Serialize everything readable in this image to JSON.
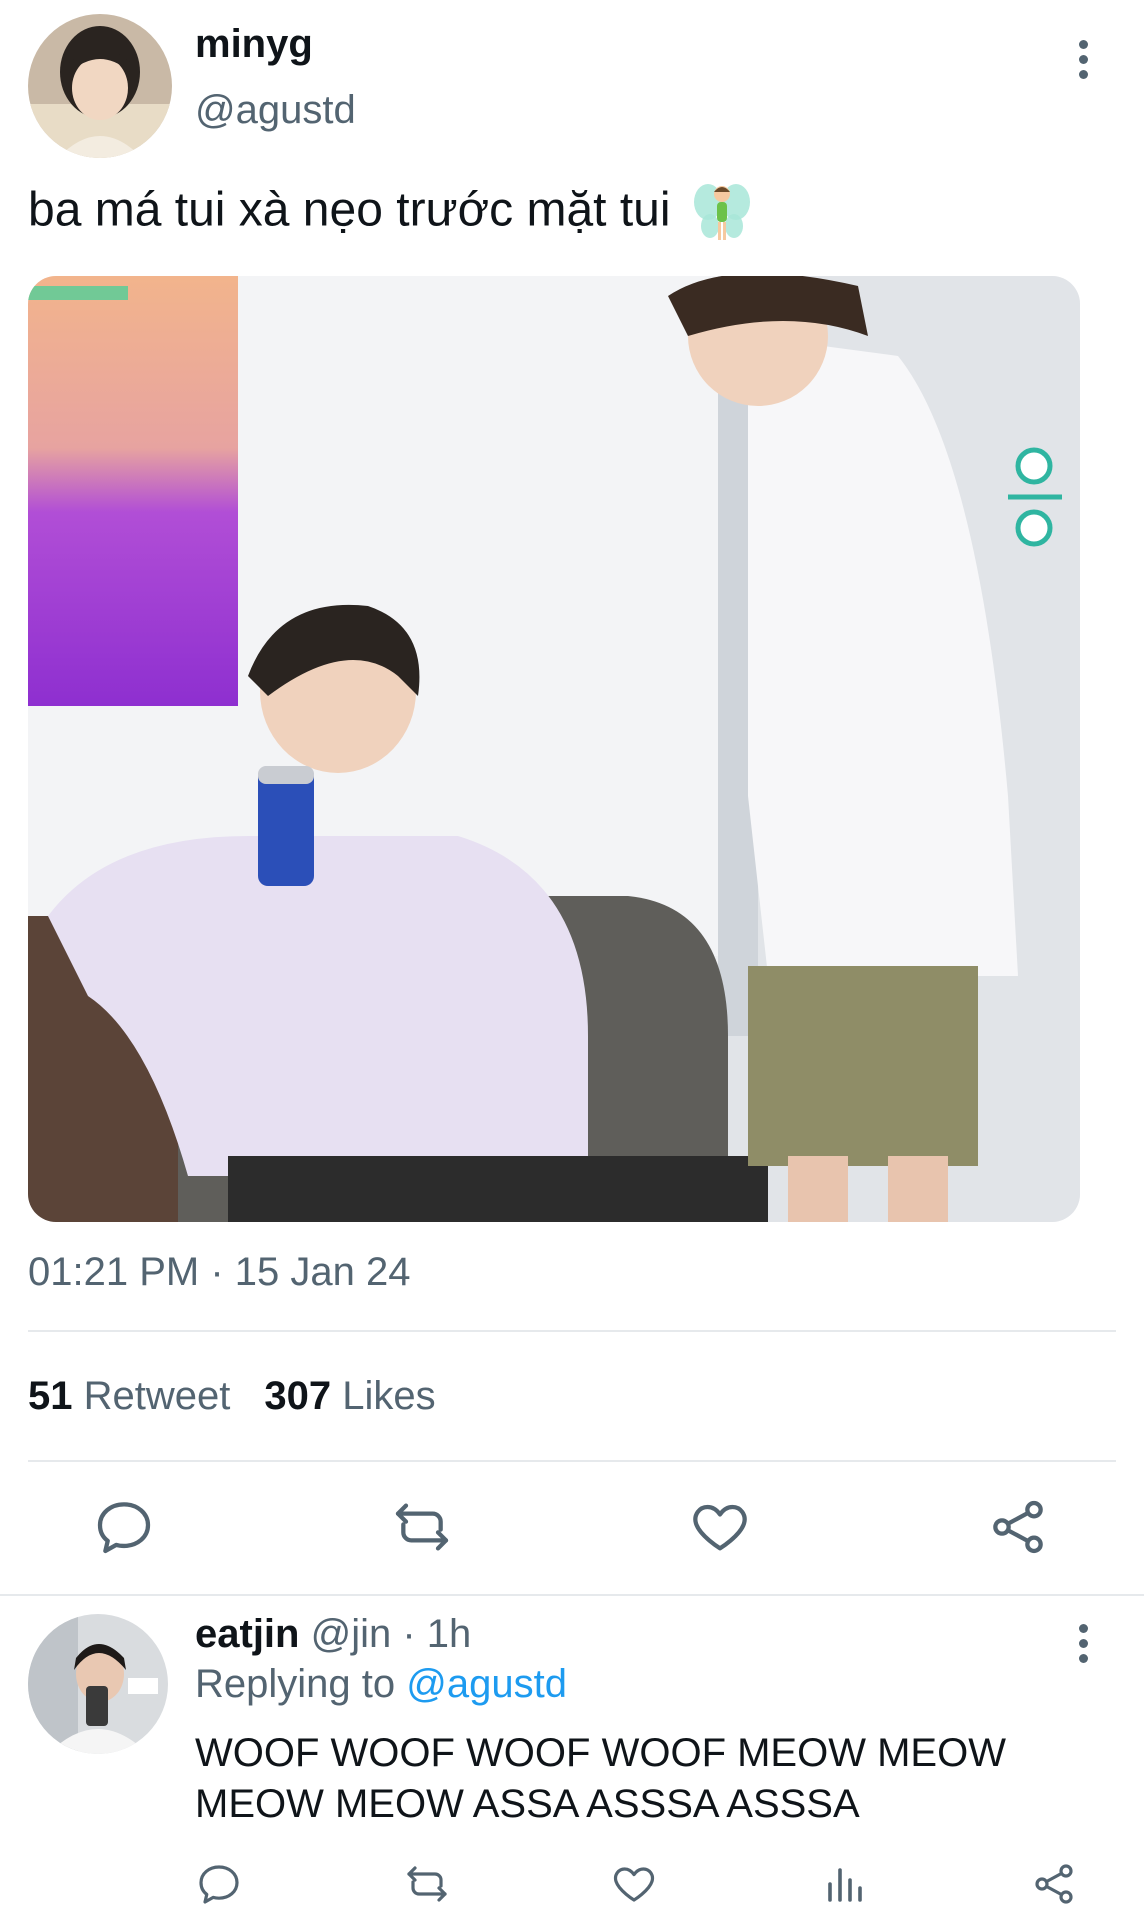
{
  "tweet": {
    "display_name": "minyg",
    "handle": "@agustd",
    "text": "ba má tui xà nẹo trước mặt tui",
    "emoji_icon": "fairy-emoji",
    "timestamp": "01:21 PM · 15 Jan 24",
    "stats": {
      "retweet_count": "51",
      "retweet_label": "Retweet",
      "likes_count": "307",
      "likes_label": "Likes"
    },
    "actions": [
      "reply-icon",
      "retweet-icon",
      "like-icon",
      "share-icon"
    ]
  },
  "reply": {
    "display_name": "eatjin",
    "handle_time": "@jin · 1h",
    "replying_label": "Replying to",
    "replying_to": "@agustd",
    "text_line1": "WOOF WOOF WOOF WOOF MEOW MEOW",
    "text_line2": "MEOW MEOW ASSA ASSSA ASSSA",
    "actions": [
      "reply-icon",
      "retweet-icon",
      "like-icon",
      "analytics-icon",
      "share-icon"
    ]
  },
  "colors": {
    "text": "#0f1419",
    "secondary": "#536471",
    "link": "#1d9bf0",
    "divider": "#e6e9ec"
  }
}
